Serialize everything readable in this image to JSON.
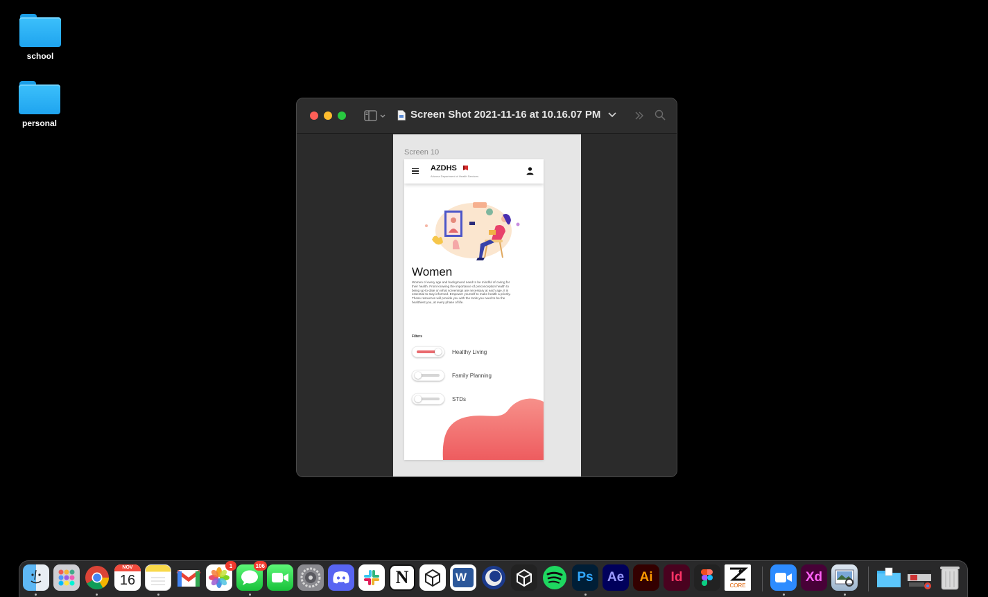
{
  "desktop": {
    "icons": [
      {
        "label": "school"
      },
      {
        "label": "personal"
      }
    ]
  },
  "window": {
    "title": "Screen Shot 2021-11-16 at 10.16.07 PM"
  },
  "mockup": {
    "frame_label": "Screen 10",
    "brand": "AZDHS",
    "brand_subtitle": "Arizona Department of Health Services",
    "heading": "Women",
    "paragraph": "Women of every age and background need to be mindful of caring for their health. From knowing the importance of preconception health to being up-to-date on what screenings are necessary at each age, it is essential to stay informed. Empower yourself to make health a priority. These resources will provide you with the tools you need to be the healthiest you, at every phase of life.",
    "filters_label": "Filters",
    "filters": [
      {
        "label": "Healthy Living",
        "on": true
      },
      {
        "label": "Family Planning",
        "on": false
      },
      {
        "label": "STDs",
        "on": false
      }
    ],
    "accent_color": "#e96a6e"
  },
  "dock": {
    "calendar_month": "NOV",
    "calendar_day": "16",
    "photos_badge": "1",
    "messages_badge": "106",
    "apps": [
      "Finder",
      "Launchpad",
      "Chrome",
      "Calendar",
      "Notes",
      "Gmail",
      "Photos",
      "Messages",
      "FaceTime",
      "System Preferences",
      "Discord",
      "Slack",
      "Notion",
      "Unity",
      "Word",
      "Cinema 4D",
      "Unity Hub",
      "Spotify",
      "Photoshop",
      "After Effects",
      "Illustrator",
      "InDesign",
      "Figma",
      "ZBrush",
      "Zoom",
      "Adobe XD",
      "Preview",
      "Downloads",
      "Recent",
      "Trash"
    ],
    "ps_label": "Ps",
    "ae_label": "Ae",
    "ai_label": "Ai",
    "id_label": "Id",
    "xd_label": "Xd",
    "w_label": "W",
    "zbrush_label": "CORE"
  }
}
